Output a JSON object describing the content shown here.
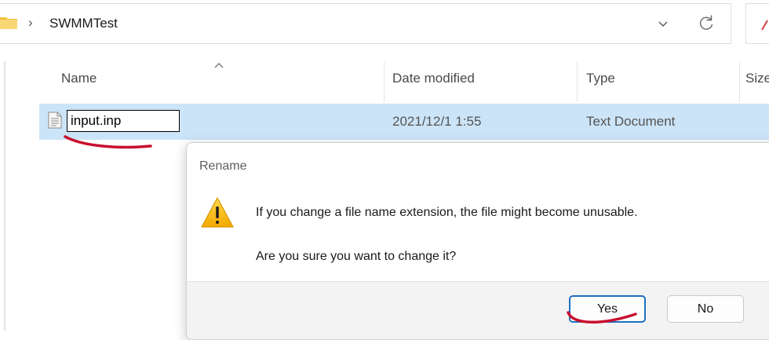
{
  "address_bar": {
    "breadcrumb": [
      "SWMMTest"
    ],
    "separator": "›"
  },
  "columns": {
    "name": "Name",
    "date_modified": "Date modified",
    "type": "Type",
    "size": "Size"
  },
  "file_row": {
    "rename_value": "input.inp",
    "date_modified": "2021/12/1 1:55",
    "type": "Text Document"
  },
  "dialog": {
    "title": "Rename",
    "message": "If you change a file name extension, the file might become unusable.",
    "question": "Are you sure you want to change it?",
    "yes_label": "Yes",
    "no_label": "No"
  },
  "colors": {
    "selection": "#cce4f7",
    "accent": "#1f6fc0",
    "annotation": "#c8102e",
    "warning": "#f5b800"
  },
  "icons": [
    "folder-icon",
    "chevron-down-icon",
    "refresh-icon",
    "sort-ascending-icon",
    "text-file-icon",
    "warning-icon"
  ]
}
